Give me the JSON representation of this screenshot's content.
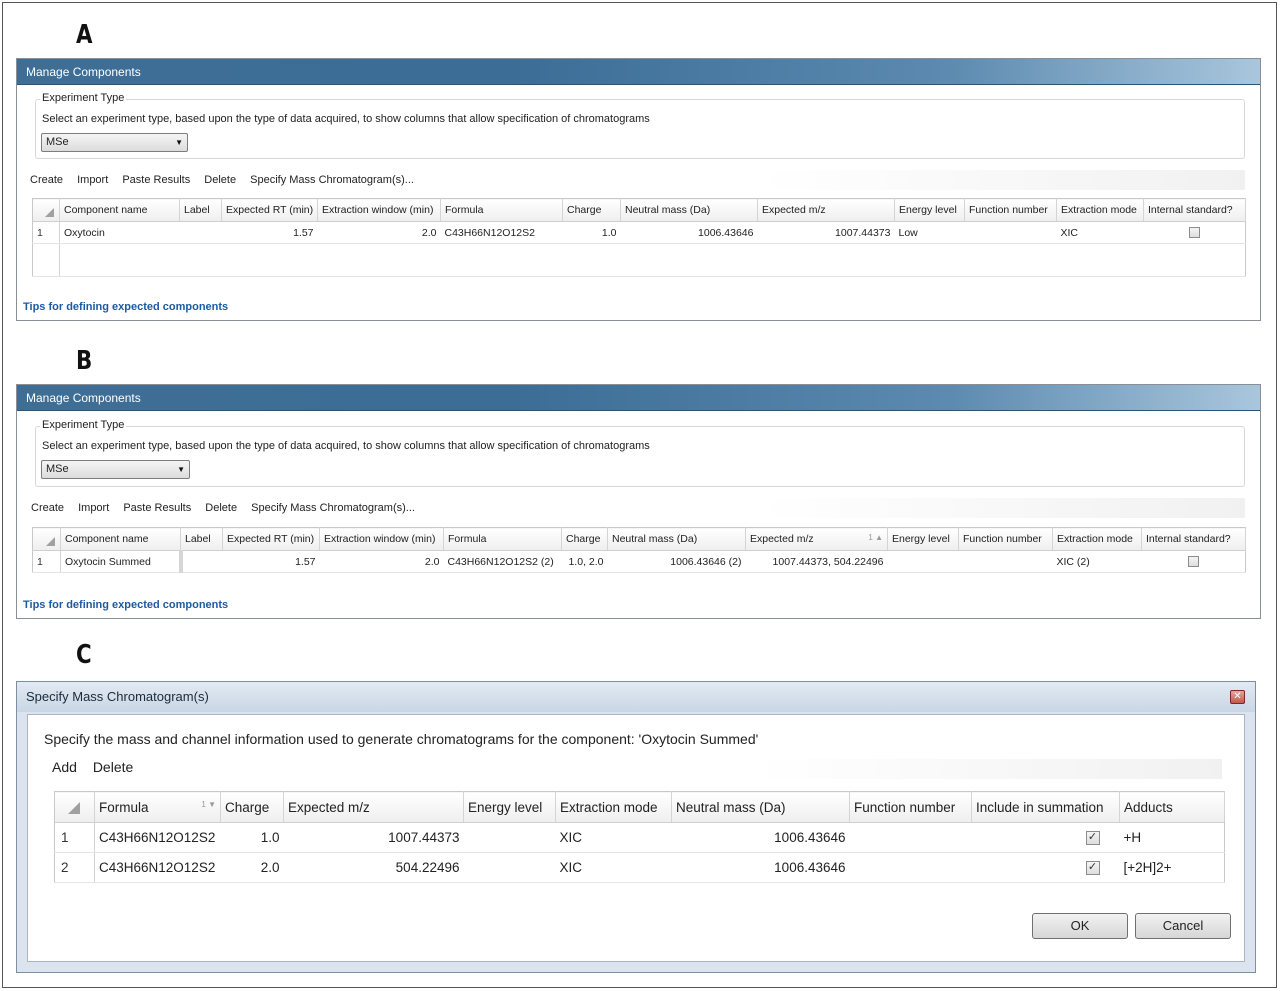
{
  "labels": {
    "a": "A",
    "b": "B",
    "c": "C"
  },
  "panel_a": {
    "title": "Manage Components",
    "group_label": "Experiment Type",
    "description": "Select an experiment type, based upon the type of data acquired, to show columns that allow specification of chromatograms",
    "experiment_type": "MSe",
    "toolbar": [
      "Create",
      "Import",
      "Paste Results",
      "Delete",
      "Specify Mass Chromatogram(s)..."
    ],
    "columns": [
      "Component name",
      "Label",
      "Expected RT (min)",
      "Extraction window (min)",
      "Formula",
      "Charge",
      "Neutral mass (Da)",
      "Expected m/z",
      "Energy level",
      "Function number",
      "Extraction mode",
      "Internal standard?"
    ],
    "rows": [
      {
        "index": "1",
        "component_name": "Oxytocin",
        "label": "",
        "expected_rt": "1.57",
        "extraction_window": "2.0",
        "formula": "C43H66N12O12S2",
        "charge": "1.0",
        "neutral_mass": "1006.43646",
        "expected_mz": "1007.44373",
        "energy_level": "Low",
        "function_number": "",
        "extraction_mode": "XIC",
        "internal_standard": false
      }
    ],
    "tips_link": "Tips for defining expected components"
  },
  "panel_b": {
    "title": "Manage Components",
    "group_label": "Experiment Type",
    "description": "Select an experiment type, based upon the type of data acquired, to show columns that allow specification of chromatograms",
    "experiment_type": "MSe",
    "toolbar": [
      "Create",
      "Import",
      "Paste Results",
      "Delete",
      "Specify Mass Chromatogram(s)..."
    ],
    "columns": [
      "Component name",
      "Label",
      "Expected RT (min)",
      "Extraction window (min)",
      "Formula",
      "Charge",
      "Neutral mass (Da)",
      "Expected m/z",
      "Energy level",
      "Function number",
      "Extraction mode",
      "Internal standard?"
    ],
    "sort_indicator": "1",
    "rows": [
      {
        "index": "1",
        "component_name": "Oxytocin Summed",
        "label": "",
        "expected_rt": "1.57",
        "extraction_window": "2.0",
        "formula": "C43H66N12O12S2 (2)",
        "charge": "1.0, 2.0",
        "neutral_mass": "1006.43646 (2)",
        "expected_mz": "1007.44373, 504.22496",
        "energy_level": "",
        "function_number": "",
        "extraction_mode": "XIC (2)",
        "internal_standard": false
      }
    ],
    "tips_link": "Tips for defining expected components"
  },
  "dialog": {
    "title": "Specify Mass Chromatogram(s)",
    "close_glyph": "✕",
    "description": "Specify the mass and channel information used to generate chromatograms for the component: 'Oxytocin Summed'",
    "toolbar": [
      "Add",
      "Delete"
    ],
    "columns": [
      "Formula",
      "Charge",
      "Expected m/z",
      "Energy level",
      "Extraction mode",
      "Neutral mass (Da)",
      "Function number",
      "Include in summation",
      "Adducts"
    ],
    "sort_indicator": "1",
    "rows": [
      {
        "index": "1",
        "formula": "C43H66N12O12S2",
        "charge": "1.0",
        "expected_mz": "1007.44373",
        "energy_level": "",
        "extraction_mode": "XIC",
        "neutral_mass": "1006.43646",
        "function_number": "",
        "include_in_summation": true,
        "adducts": "+H"
      },
      {
        "index": "2",
        "formula": "C43H66N12O12S2",
        "charge": "2.0",
        "expected_mz": "504.22496",
        "energy_level": "",
        "extraction_mode": "XIC",
        "neutral_mass": "1006.43646",
        "function_number": "",
        "include_in_summation": true,
        "adducts": "[+2H]2+"
      }
    ],
    "ok_label": "OK",
    "cancel_label": "Cancel"
  }
}
